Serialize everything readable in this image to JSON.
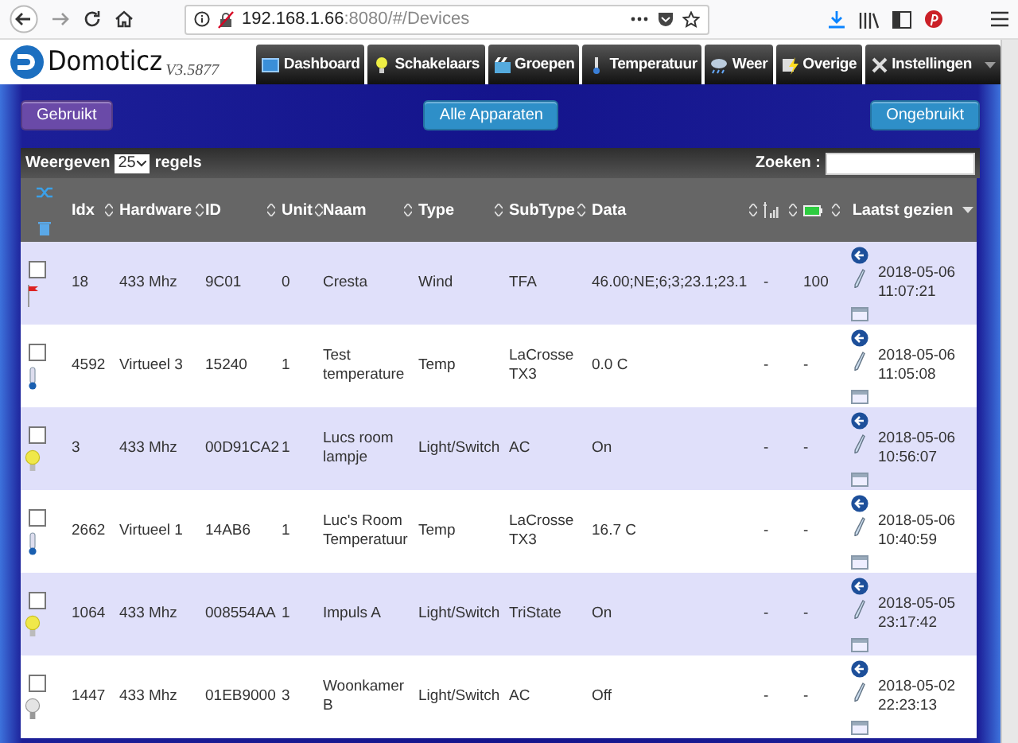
{
  "browser": {
    "url_host": "192.168.1.66",
    "url_rest": ":8080/#/Devices"
  },
  "app": {
    "logo": "Domoticz",
    "version": "V3.5877"
  },
  "nav": [
    {
      "kind": "dashboard",
      "label": "Dashboard",
      "has_menu": false
    },
    {
      "kind": "switches",
      "label": "Schakelaars",
      "has_menu": false
    },
    {
      "kind": "scenes",
      "label": "Groepen",
      "has_menu": false
    },
    {
      "kind": "temperature",
      "label": "Temperatuur",
      "has_menu": false
    },
    {
      "kind": "weather",
      "label": "Weer",
      "has_menu": false
    },
    {
      "kind": "utility",
      "label": "Overige",
      "has_menu": false
    },
    {
      "kind": "setup",
      "label": "Instellingen",
      "has_menu": true
    }
  ],
  "filters": [
    {
      "label": "Gebruikt",
      "color": "#6a4aa8"
    },
    {
      "label": "Alle Apparaten",
      "color": "#2e8fc8"
    },
    {
      "label": "Ongebruikt",
      "color": "#2e8fc8"
    }
  ],
  "table": {
    "show_label": "Weergeven",
    "page_size": "25",
    "rows_label": "regels",
    "search_label": "Zoeken :",
    "columns": [
      {
        "kind": "text",
        "label": "Idx",
        "sorted": false
      },
      {
        "kind": "text",
        "label": "Hardware",
        "sorted": false
      },
      {
        "kind": "text",
        "label": "ID",
        "sorted": false
      },
      {
        "kind": "text",
        "label": "Unit",
        "sorted": false
      },
      {
        "kind": "text",
        "label": "Naam",
        "sorted": false
      },
      {
        "kind": "text",
        "label": "Type",
        "sorted": false
      },
      {
        "kind": "text",
        "label": "SubType",
        "sorted": false
      },
      {
        "kind": "text",
        "label": "Data",
        "sorted": false
      },
      {
        "kind": "signal",
        "sorted": false
      },
      {
        "kind": "battery",
        "sorted": false
      },
      {
        "kind": "text",
        "label": "Laatst gezien",
        "sorted": true
      }
    ],
    "rows": [
      {
        "checked": false,
        "kind": "wind",
        "idx": "18",
        "hardware": "433 Mhz",
        "id": "9C01",
        "unit": "0",
        "name": "Cresta",
        "type": "Wind",
        "subtype": "TFA",
        "data": "46.00;NE;6;3;23.1;23.1",
        "signal": "-",
        "battery": "100",
        "last_seen": "2018-05-06 11:07:21"
      },
      {
        "checked": false,
        "kind": "temp",
        "idx": "4592",
        "hardware": "Virtueel 3",
        "id": "15240",
        "unit": "1",
        "name": "Test temperature",
        "type": "Temp",
        "subtype": "LaCrosse TX3",
        "data": "0.0 C",
        "signal": "-",
        "battery": "-",
        "last_seen": "2018-05-06 11:05:08"
      },
      {
        "checked": false,
        "kind": "light_on",
        "idx": "3",
        "hardware": "433 Mhz",
        "id": "00D91CA2",
        "unit": "1",
        "name": "Lucs room lampje",
        "type": "Light/Switch",
        "subtype": "AC",
        "data": "On",
        "signal": "-",
        "battery": "-",
        "last_seen": "2018-05-06 10:56:07"
      },
      {
        "checked": false,
        "kind": "temp",
        "idx": "2662",
        "hardware": "Virtueel 1",
        "id": "14AB6",
        "unit": "1",
        "name": "Luc's Room Temperatuur",
        "type": "Temp",
        "subtype": "LaCrosse TX3",
        "data": "16.7 C",
        "signal": "-",
        "battery": "-",
        "last_seen": "2018-05-06 10:40:59"
      },
      {
        "checked": false,
        "kind": "light_on",
        "idx": "1064",
        "hardware": "433 Mhz",
        "id": "008554AA",
        "unit": "1",
        "name": "Impuls A",
        "type": "Light/Switch",
        "subtype": "TriState",
        "data": "On",
        "signal": "-",
        "battery": "-",
        "last_seen": "2018-05-05 23:17:42"
      },
      {
        "checked": false,
        "kind": "light_off",
        "idx": "1447",
        "hardware": "433 Mhz",
        "id": "01EB9000",
        "unit": "3",
        "name": "Woonkamer B",
        "type": "Light/Switch",
        "subtype": "AC",
        "data": "Off",
        "signal": "-",
        "battery": "-",
        "last_seen": "2018-05-02 22:23:13"
      }
    ]
  }
}
